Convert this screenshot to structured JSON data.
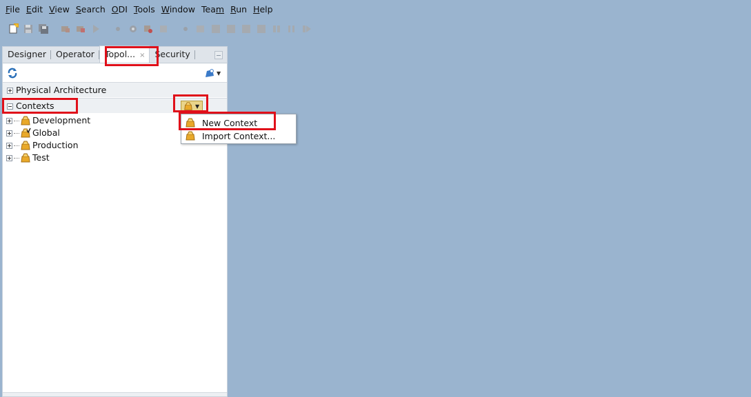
{
  "menubar": {
    "items": [
      {
        "pre": "",
        "mn": "F",
        "post": "ile"
      },
      {
        "pre": "",
        "mn": "E",
        "post": "dit"
      },
      {
        "pre": "",
        "mn": "V",
        "post": "iew"
      },
      {
        "pre": "",
        "mn": "S",
        "post": "earch"
      },
      {
        "pre": "",
        "mn": "O",
        "post": "DI"
      },
      {
        "pre": "",
        "mn": "T",
        "post": "ools"
      },
      {
        "pre": "",
        "mn": "W",
        "post": "indow"
      },
      {
        "pre": "Tea",
        "mn": "m",
        "post": ""
      },
      {
        "pre": "",
        "mn": "R",
        "post": "un"
      },
      {
        "pre": "",
        "mn": "H",
        "post": "elp"
      }
    ]
  },
  "tabs": {
    "designer": "Designer",
    "operator": "Operator",
    "topology": "Topol...",
    "topology_close": "×",
    "security": "Security"
  },
  "sections": {
    "physical": "Physical Architecture",
    "contexts": "Contexts"
  },
  "contexts": [
    "Development",
    "Global",
    "Production",
    "Test"
  ],
  "popup": {
    "new_context": "New Context",
    "import_context": "Import Context..."
  },
  "colors": {
    "background": "#9ab4cf",
    "highlight": "#e0101a",
    "context_icon": "#e9a92a"
  },
  "icons": {
    "toolbar": [
      "new-file-icon",
      "save-icon",
      "save-all-icon",
      "debug-icon",
      "execute-debug-icon",
      "run-icon",
      "breakpoint-icon",
      "settings-icon",
      "step-icon",
      "step-over-icon",
      "step-into-icon",
      "step-out-icon",
      "step-return-icon",
      "resume-icon",
      "pause-icon",
      "stop-icon",
      "skip-icon"
    ],
    "context": "context-icon",
    "refresh": "refresh-icon"
  }
}
